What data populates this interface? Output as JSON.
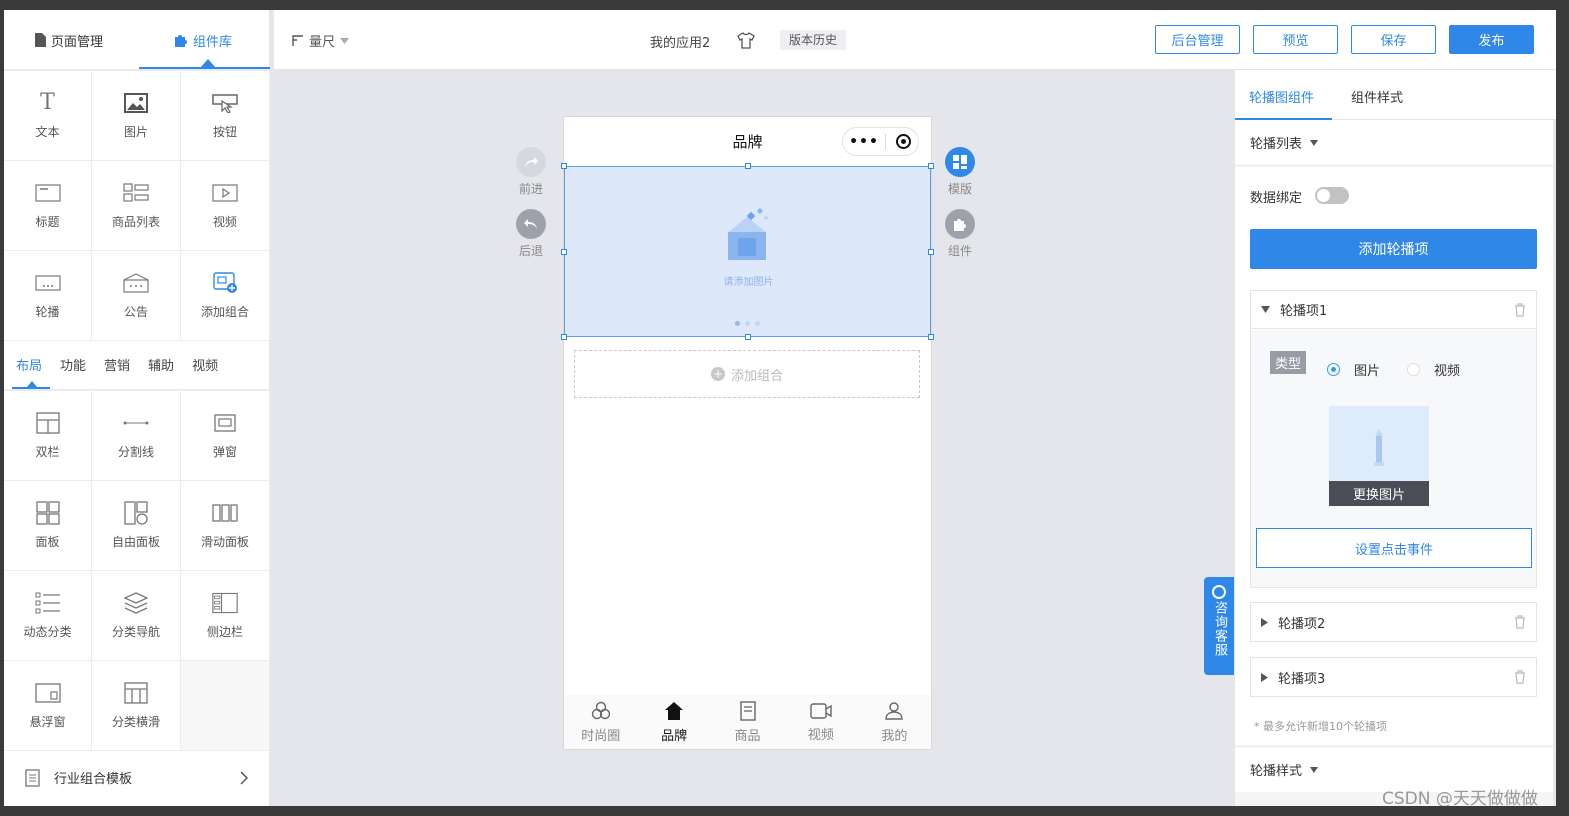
{
  "left_panel": {
    "tabs": [
      {
        "label": "页面管理",
        "icon": "file-icon"
      },
      {
        "label": "组件库",
        "icon": "puzzle-icon"
      }
    ],
    "basic_components": [
      {
        "label": "文本",
        "icon": "text-icon"
      },
      {
        "label": "图片",
        "icon": "image-icon"
      },
      {
        "label": "按钮",
        "icon": "button-icon"
      },
      {
        "label": "标题",
        "icon": "title-icon"
      },
      {
        "label": "商品列表",
        "icon": "product-list-icon"
      },
      {
        "label": "视频",
        "icon": "video-icon"
      },
      {
        "label": "轮播",
        "icon": "carousel-icon"
      },
      {
        "label": "公告",
        "icon": "notice-icon"
      },
      {
        "label": "添加组合",
        "icon": "add-combo-icon"
      }
    ],
    "categories": [
      "布局",
      "功能",
      "营销",
      "辅助",
      "视频"
    ],
    "layout_components": [
      {
        "label": "双栏",
        "icon": "two-column-icon"
      },
      {
        "label": "分割线",
        "icon": "divider-icon"
      },
      {
        "label": "弹窗",
        "icon": "popup-icon"
      },
      {
        "label": "面板",
        "icon": "panel-icon"
      },
      {
        "label": "自由面板",
        "icon": "free-panel-icon"
      },
      {
        "label": "滑动面板",
        "icon": "slide-panel-icon"
      },
      {
        "label": "动态分类",
        "icon": "dynamic-category-icon"
      },
      {
        "label": "分类导航",
        "icon": "category-nav-icon"
      },
      {
        "label": "侧边栏",
        "icon": "sidebar-icon"
      },
      {
        "label": "悬浮窗",
        "icon": "float-window-icon"
      },
      {
        "label": "分类横滑",
        "icon": "category-scroll-icon"
      }
    ],
    "footer": {
      "label": "行业组合模板"
    }
  },
  "topbar": {
    "ruler_label": "量尺",
    "app_name": "我的应用2",
    "version_history": "版本历史",
    "buttons": {
      "admin": "后台管理",
      "preview": "预览",
      "save": "保存",
      "publish": "发布"
    }
  },
  "canvas": {
    "forward": "前进",
    "back": "后退",
    "template": "模版",
    "component": "组件",
    "phone_title": "品牌",
    "carousel_placeholder": "请添加图片",
    "add_combo": "添加组合",
    "tabbar": [
      "时尚圈",
      "品牌",
      "商品",
      "视频",
      "我的"
    ]
  },
  "consult": "咨询客服",
  "right_panel": {
    "tabs": [
      "轮播图组件",
      "组件样式"
    ],
    "carousel_list": "轮播列表",
    "data_binding": "数据绑定",
    "add_item": "添加轮播项",
    "items": [
      "轮播项1",
      "轮播项2",
      "轮播项3"
    ],
    "type_label": "类型",
    "type_options": [
      "图片",
      "视频"
    ],
    "change_image": "更换图片",
    "set_click_event": "设置点击事件",
    "max_note": "* 最多允许新增10个轮播项",
    "carousel_style": "轮播样式"
  },
  "watermark": "CSDN @天天做做做",
  "colors": {
    "accent": "#2f88e8",
    "selection": "#dde9fb"
  }
}
